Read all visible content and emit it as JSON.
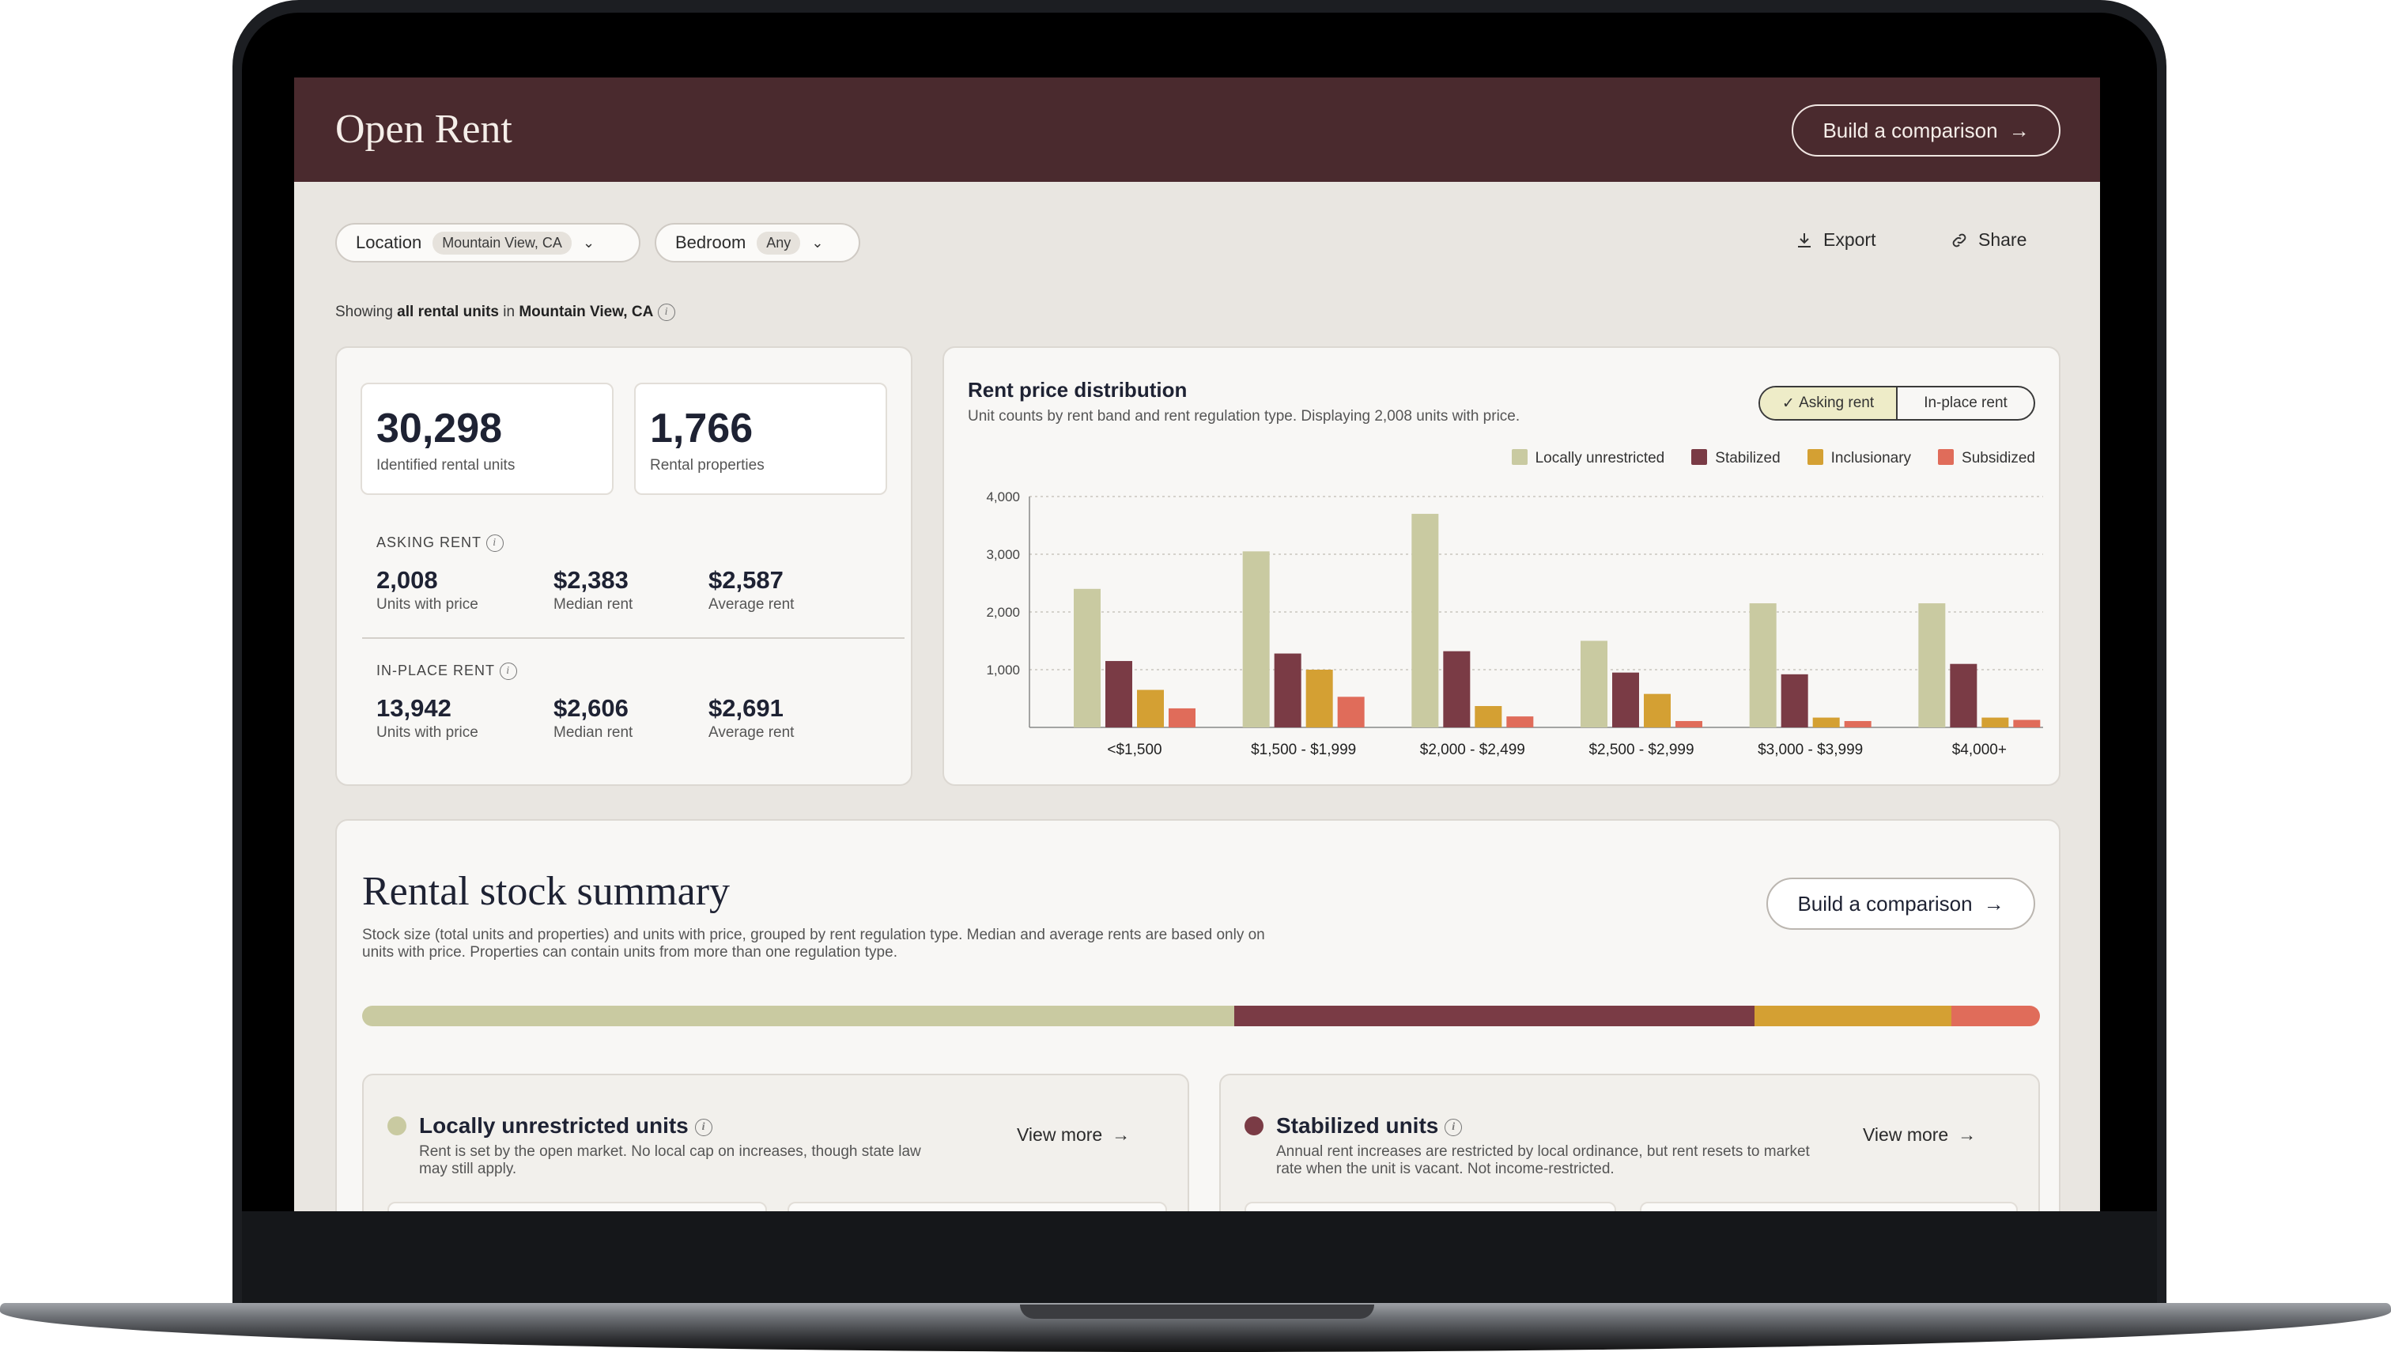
{
  "app": {
    "title": "Open Rent",
    "header_button": "Build a comparison",
    "arrow": "→"
  },
  "filters": [
    {
      "label": "Location",
      "value": "Mountain View, CA"
    },
    {
      "label": "Bedroom",
      "value": "Any"
    }
  ],
  "actions": {
    "export": "Export",
    "share": "Share"
  },
  "showing": {
    "prefix": "Showing",
    "bold1": "all rental units",
    "mid": "in",
    "bold2": "Mountain View, CA"
  },
  "summary": {
    "units": {
      "value": "30,298",
      "label": "Identified rental units"
    },
    "properties": {
      "value": "1,766",
      "label": "Rental properties"
    },
    "asking": {
      "title": "ASKING RENT",
      "metrics": [
        {
          "value": "2,008",
          "label": "Units with price"
        },
        {
          "value": "$2,383",
          "label": "Median rent"
        },
        {
          "value": "$2,587",
          "label": "Average rent"
        }
      ]
    },
    "inplace": {
      "title": "IN-PLACE RENT",
      "metrics": [
        {
          "value": "13,942",
          "label": "Units with price"
        },
        {
          "value": "$2,606",
          "label": "Median rent"
        },
        {
          "value": "$2,691",
          "label": "Average rent"
        }
      ]
    }
  },
  "distribution": {
    "title": "Rent price distribution",
    "subtitle": "Unit counts by rent band and rent regulation type. Displaying 2,008 units with price.",
    "toggle": {
      "on": "Asking rent",
      "off": "In-place rent",
      "check": "✓"
    }
  },
  "chart_data": {
    "type": "bar",
    "categories": [
      "<$1,500",
      "$1,500 - $1,999",
      "$2,000 - $2,499",
      "$2,500 - $2,999",
      "$3,000 - $3,999",
      "$4,000+"
    ],
    "series": [
      {
        "name": "Locally unrestricted",
        "color": "#c9caa1",
        "values": [
          2400,
          3050,
          3700,
          1500,
          2150,
          2150
        ]
      },
      {
        "name": "Stabilized",
        "color": "#7a3b45",
        "values": [
          1150,
          1280,
          1320,
          950,
          920,
          1100
        ]
      },
      {
        "name": "Inclusionary",
        "color": "#d4a033",
        "values": [
          650,
          1000,
          370,
          580,
          170,
          170
        ]
      },
      {
        "name": "Subsidized",
        "color": "#e06c5a",
        "values": [
          330,
          530,
          190,
          110,
          110,
          130
        ]
      }
    ],
    "yticks": [
      "1,000",
      "2,000",
      "3,000",
      "4,000"
    ],
    "ylim": [
      0,
      4000
    ],
    "grid": true,
    "legend": "top-right"
  },
  "stock": {
    "title": "Rental stock summary",
    "description": "Stock size (total units and properties) and units with price, grouped by rent regulation type. Median and average rents are based only on units with price. Properties can contain units from more than one regulation type.",
    "button": "Build a comparison",
    "shares": [
      0.52,
      0.31,
      0.117,
      0.053
    ],
    "colors": [
      "#c9caa1",
      "#7a3b45",
      "#d4a033",
      "#e06c5a"
    ],
    "cards": [
      {
        "title": "Locally unrestricted units",
        "description": "Rent is set by the open market. No local cap on increases, though state law may still apply.",
        "link": "View more"
      },
      {
        "title": "Stabilized units",
        "description": "Annual rent increases are restricted by local ordinance, but rent resets to market rate when the unit is vacant. Not income-restricted.",
        "link": "View more"
      }
    ]
  }
}
